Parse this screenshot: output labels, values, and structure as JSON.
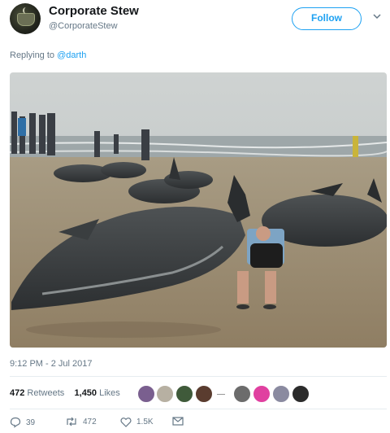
{
  "tweet": {
    "display_name": "Corporate Stew",
    "handle": "@CorporateStew",
    "follow_label": "Follow",
    "reply_prefix": "Replying to",
    "reply_to": "@darth",
    "timestamp": "9:12 PM - 2 Jul 2017",
    "retweets_count": "472",
    "retweets_label": "Retweets",
    "likes_count": "1,450",
    "likes_label": "Likes",
    "actions": {
      "reply_count": "39",
      "retweet_count": "472",
      "like_count": "1.5K"
    },
    "image_description_icon": "beach-photo"
  },
  "colors": {
    "accent": "#1da1f2",
    "text": "#14171a",
    "muted": "#657786"
  }
}
